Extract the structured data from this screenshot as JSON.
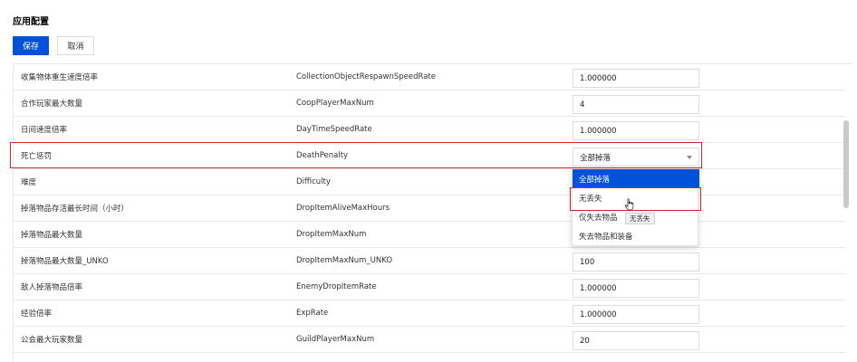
{
  "page": {
    "title": "应用配置"
  },
  "toolbar": {
    "save_label": "保存",
    "cancel_label": "取消"
  },
  "rows": [
    {
      "label": "收集物体重生速度倍率",
      "key": "CollectionObjectRespawnSpeedRate",
      "value": "1.000000"
    },
    {
      "label": "合作玩家最大数量",
      "key": "CoopPlayerMaxNum",
      "value": "4"
    },
    {
      "label": "日间速度倍率",
      "key": "DayTimeSpeedRate",
      "value": "1.000000"
    },
    {
      "label": "死亡惩罚",
      "key": "DeathPenalty",
      "value": "全部掉落"
    },
    {
      "label": "难度",
      "key": "Difficulty",
      "value": ""
    },
    {
      "label": "掉落物品存活最长时间（小时）",
      "key": "DropItemAliveMaxHours",
      "value": ""
    },
    {
      "label": "掉落物品最大数量",
      "key": "DropItemMaxNum",
      "value": ""
    },
    {
      "label": "掉落物品最大数量_UNKO",
      "key": "DropItemMaxNum_UNKO",
      "value": "100"
    },
    {
      "label": "敌人掉落物品倍率",
      "key": "EnemyDropItemRate",
      "value": "1.000000"
    },
    {
      "label": "经验倍率",
      "key": "ExpRate",
      "value": "1.000000"
    },
    {
      "label": "公会最大玩家数量",
      "key": "GuildPlayerMaxNum",
      "value": "20"
    }
  ],
  "dropdown": {
    "options": [
      "全部掉落",
      "无丢失",
      "仅失去物品",
      "失去物品和装备"
    ],
    "selected": "全部掉落",
    "hovered": "无丢失",
    "tooltip": "无丢失"
  }
}
